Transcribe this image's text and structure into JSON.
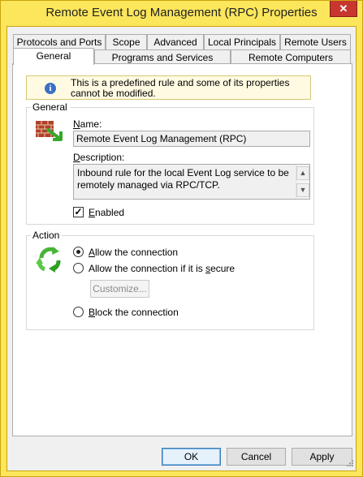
{
  "window": {
    "title": "Remote Event Log Management (RPC) Properties",
    "close_glyph": "✕"
  },
  "tabs": {
    "row_back": [
      "Protocols and Ports",
      "Scope",
      "Advanced",
      "Local Principals",
      "Remote Users"
    ],
    "row_front": [
      "General",
      "Programs and Services",
      "Remote Computers"
    ],
    "selected": "General"
  },
  "info": {
    "icon_glyph": "i",
    "text": "This is a predefined rule and some of its properties cannot be modified."
  },
  "general": {
    "group_label": "General",
    "name_label_key": "N",
    "name_label_rest": "ame:",
    "name_value": "Remote Event Log Management (RPC)",
    "description_label_key": "D",
    "description_label_rest": "escription:",
    "description_value": "Inbound rule for the local Event Log service to be remotely managed via RPC/TCP.",
    "enabled_label_key": "E",
    "enabled_label_rest": "nabled",
    "enabled_checked": true,
    "check_glyph": "✓",
    "scroll_up_glyph": "▲",
    "scroll_down_glyph": "▼"
  },
  "action": {
    "group_label": "Action",
    "options": [
      {
        "key": "A",
        "rest": "llow the connection",
        "checked": true
      },
      {
        "pre": "Allow the connection if it is ",
        "key": "s",
        "rest": "ecure",
        "checked": false
      },
      {
        "key": "B",
        "rest": "lock the connection",
        "checked": false
      }
    ],
    "customize_label": "Customize..."
  },
  "buttons": {
    "ok": "OK",
    "cancel": "Cancel",
    "apply": "Apply"
  },
  "colors": {
    "title_bar": "#fbe65c",
    "close_button": "#c7372f",
    "info_bar": "#fffae1"
  }
}
